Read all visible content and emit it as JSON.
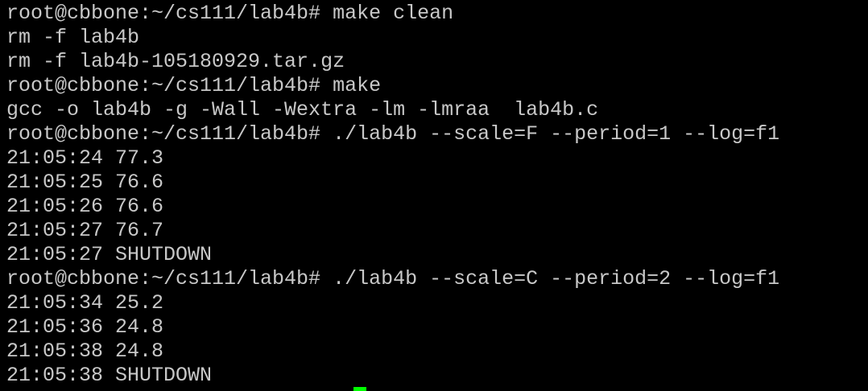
{
  "terminal": {
    "lines": [
      "root@cbbone:~/cs111/lab4b# make clean",
      "rm -f lab4b",
      "rm -f lab4b-105180929.tar.gz",
      "root@cbbone:~/cs111/lab4b# make",
      "gcc -o lab4b -g -Wall -Wextra -lm -lmraa  lab4b.c",
      "root@cbbone:~/cs111/lab4b# ./lab4b --scale=F --period=1 --log=f1",
      "21:05:24 77.3",
      "21:05:25 76.6",
      "21:05:26 76.6",
      "21:05:27 76.7",
      "21:05:27 SHUTDOWN",
      "root@cbbone:~/cs111/lab4b# ./lab4b --scale=C --period=2 --log=f1",
      "21:05:34 25.2",
      "21:05:36 24.8",
      "21:05:38 24.8",
      "21:05:38 SHUTDOWN"
    ]
  },
  "colors": {
    "background": "#000000",
    "text": "#c8c8c8",
    "cursor": "#00ff00"
  }
}
